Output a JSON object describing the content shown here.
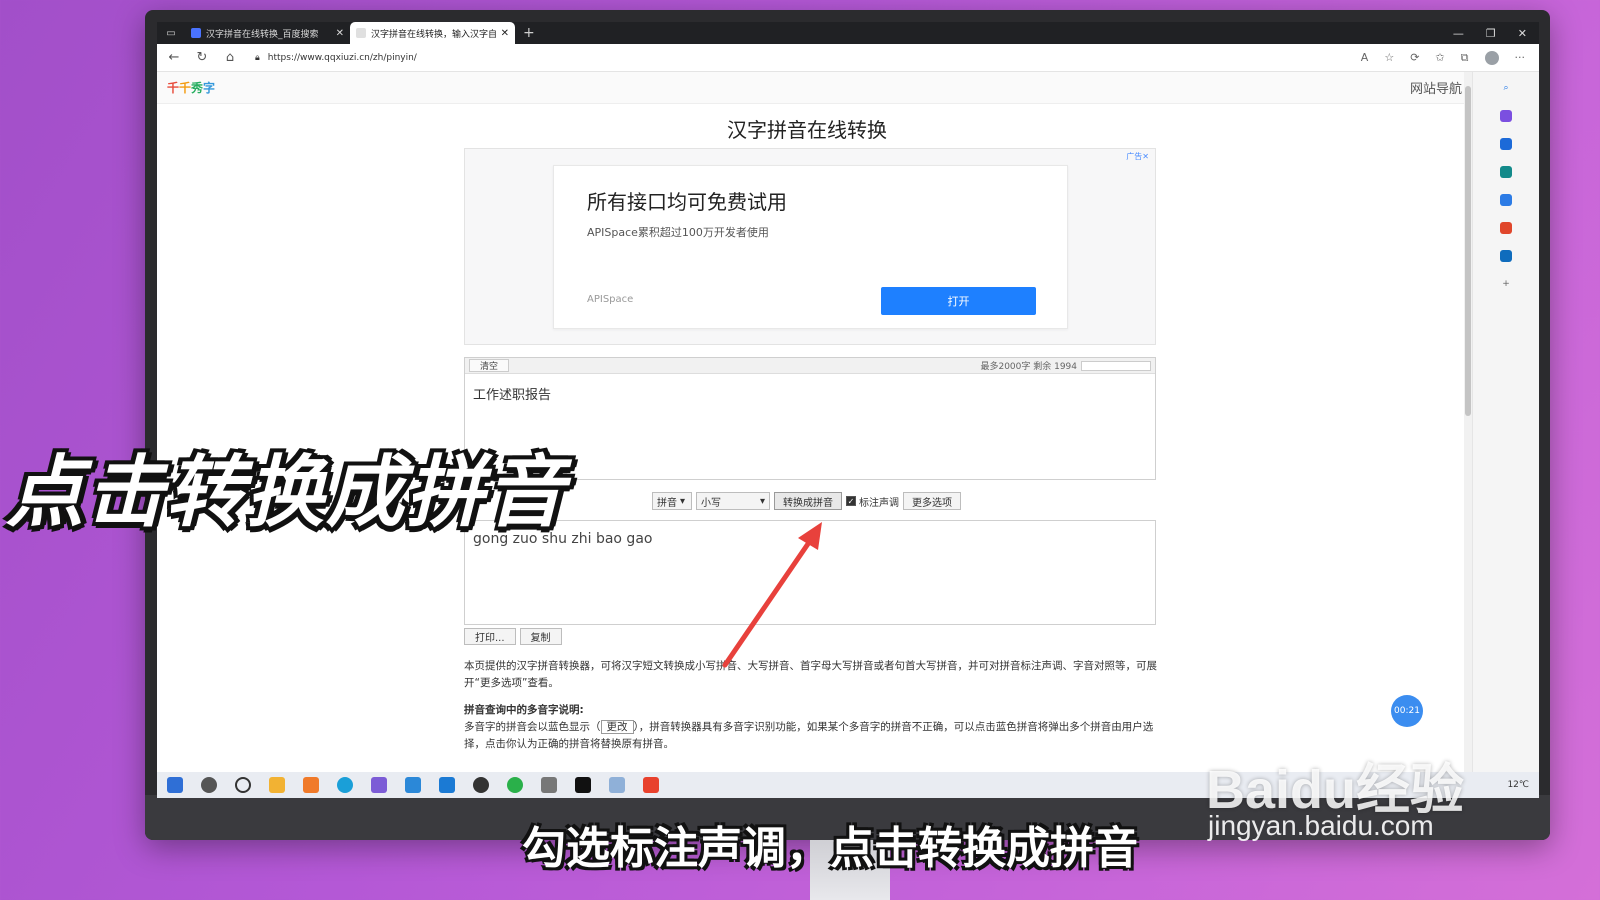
{
  "browser": {
    "tabs": [
      {
        "label": "汉字拼音在线转换_百度搜索",
        "active": false
      },
      {
        "label": "汉字拼音在线转换，输入汉字自动转换",
        "active": true
      }
    ],
    "new_tab": "+",
    "url": "https://www.qqxiuzi.cn/zh/pinyin/"
  },
  "site": {
    "logo": [
      "千",
      "千",
      "秀",
      "字"
    ],
    "nav": "网站导航",
    "title": "汉字拼音在线转换"
  },
  "ad": {
    "tag": "广告✕",
    "title": "所有接口均可免费试用",
    "subtitle": "APISpace累积超过100万开发者使用",
    "brand": "APISpace",
    "button": "打开"
  },
  "input": {
    "clear_label": "清空",
    "limit_text": "最多2000字 剩余 1994",
    "text": "工作述职报告"
  },
  "controls": {
    "mode_select": "拼音",
    "case_select": "小写",
    "convert_label": "转换成拼音",
    "tone_label": "标注声调",
    "tone_checked": true,
    "more_label": "更多选项"
  },
  "output": {
    "text": "gong zuo shu zhi bao gao",
    "print_label": "打印...",
    "copy_label": "复制"
  },
  "description": {
    "p1": "本页提供的汉字拼音转换器，可将汉字短文转换成小写拼音、大写拼音、首字母大写拼音或者句首大写拼音，并可对拼音标注声调、字音对照等，可展开“更多选项”查看。",
    "heading": "拼音查询中的多音字说明:",
    "p2_before": "多音字的拼音会以蓝色显示（",
    "p2_tag": "更改",
    "p2_after": "），拼音转换器具有多音字识别功能，如果某个多音字的拼音不正确，可以点击蓝色拼音将弹出多个拼音由用户选择，点击你认为正确的拼音将替换原有拼音。"
  },
  "timer": "00:21",
  "taskbar": {
    "tray_text": "12℃"
  },
  "overlay": {
    "title": "点击转换成拼音",
    "subtitle": "勾选标注声调，点击转换成拼音",
    "watermark": "Baidu经验",
    "watermark_url": "jingyan.baidu.com"
  },
  "colors": {
    "accent_blue": "#1e80ff",
    "arrow_red": "#e8413c",
    "background_purple": "#b458d6"
  }
}
